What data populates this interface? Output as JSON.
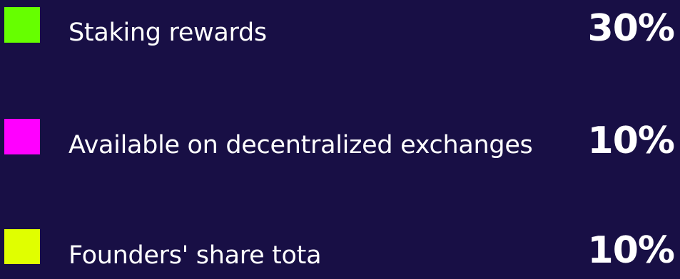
{
  "theme": {
    "background": "#180f45",
    "text": "#ffffff"
  },
  "legend": {
    "items": [
      {
        "label": "Staking rewards",
        "percent": "30%",
        "color": "#66ff00"
      },
      {
        "label": "Available on decentralized exchanges",
        "percent": "10%",
        "color": "#ff00ff"
      },
      {
        "label": "Founders' share tota",
        "percent": "10%",
        "color": "#e0ff00"
      }
    ]
  }
}
